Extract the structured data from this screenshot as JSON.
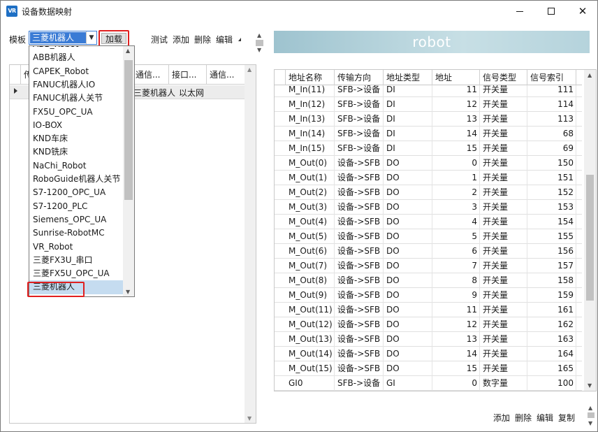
{
  "window": {
    "title": "设备数据映射",
    "icon_text": "VR"
  },
  "toolbar": {
    "template_label": "模板",
    "template_value": "三菱机器人",
    "load_label": "加载",
    "test_label": "测试",
    "add_label": "添加",
    "delete_label": "删除",
    "edit_label": "编辑"
  },
  "dropdown": {
    "options": [
      "ABB_Robot",
      "ABB机器人",
      "CAPEK_Robot",
      "FANUC机器人IO",
      "FANUC机器人关节",
      "FX5U_OPC_UA",
      "IO-BOX",
      "KND车床",
      "KND铣床",
      "NaChi_Robot",
      "RoboGuide机器人关节",
      "S7-1200_OPC_UA",
      "S7-1200_PLC",
      "Siemens_OPC_UA",
      "Sunrise-RobotMC",
      "VR_Robot",
      "三菱FX3U_串口",
      "三菱FX5U_OPC_UA",
      "三菱机器人"
    ],
    "selected_index": 18
  },
  "left_grid": {
    "headers": [
      "传",
      "",
      "通信...",
      "接口...",
      "通信..."
    ],
    "row": {
      "name": "三菱机器人",
      "interface": "以太网"
    }
  },
  "banner": {
    "title": "robot"
  },
  "right_grid": {
    "headers": [
      "地址名称",
      "传输方向",
      "地址类型",
      "地址",
      "信号类型",
      "信号索引"
    ],
    "rows": [
      [
        "M_In(11)",
        "SFB->设备",
        "DI",
        "11",
        "开关量",
        "111"
      ],
      [
        "M_In(12)",
        "SFB->设备",
        "DI",
        "12",
        "开关量",
        "114"
      ],
      [
        "M_In(13)",
        "SFB->设备",
        "DI",
        "13",
        "开关量",
        "113"
      ],
      [
        "M_In(14)",
        "SFB->设备",
        "DI",
        "14",
        "开关量",
        "68"
      ],
      [
        "M_In(15)",
        "SFB->设备",
        "DI",
        "15",
        "开关量",
        "69"
      ],
      [
        "M_Out(0)",
        "设备->SFB",
        "DO",
        "0",
        "开关量",
        "150"
      ],
      [
        "M_Out(1)",
        "设备->SFB",
        "DO",
        "1",
        "开关量",
        "151"
      ],
      [
        "M_Out(2)",
        "设备->SFB",
        "DO",
        "2",
        "开关量",
        "152"
      ],
      [
        "M_Out(3)",
        "设备->SFB",
        "DO",
        "3",
        "开关量",
        "153"
      ],
      [
        "M_Out(4)",
        "设备->SFB",
        "DO",
        "4",
        "开关量",
        "154"
      ],
      [
        "M_Out(5)",
        "设备->SFB",
        "DO",
        "5",
        "开关量",
        "155"
      ],
      [
        "M_Out(6)",
        "设备->SFB",
        "DO",
        "6",
        "开关量",
        "156"
      ],
      [
        "M_Out(7)",
        "设备->SFB",
        "DO",
        "7",
        "开关量",
        "157"
      ],
      [
        "M_Out(8)",
        "设备->SFB",
        "DO",
        "8",
        "开关量",
        "158"
      ],
      [
        "M_Out(9)",
        "设备->SFB",
        "DO",
        "9",
        "开关量",
        "159"
      ],
      [
        "M_Out(11)",
        "设备->SFB",
        "DO",
        "11",
        "开关量",
        "161"
      ],
      [
        "M_Out(12)",
        "设备->SFB",
        "DO",
        "12",
        "开关量",
        "162"
      ],
      [
        "M_Out(13)",
        "设备->SFB",
        "DO",
        "13",
        "开关量",
        "163"
      ],
      [
        "M_Out(14)",
        "设备->SFB",
        "DO",
        "14",
        "开关量",
        "164"
      ],
      [
        "M_Out(15)",
        "设备->SFB",
        "DO",
        "15",
        "开关量",
        "165"
      ],
      [
        "GI0",
        "SFB->设备",
        "GI",
        "0",
        "数字量",
        "100"
      ]
    ]
  },
  "bottom_actions": {
    "add_label": "添加",
    "delete_label": "删除",
    "edit_label": "编辑",
    "copy_label": "复制"
  },
  "colors": {
    "highlight_border": "#e02020",
    "selection_blue": "#3a7bd5",
    "selected_row": "#c5dcf0",
    "banner": "#b5d3dc"
  }
}
